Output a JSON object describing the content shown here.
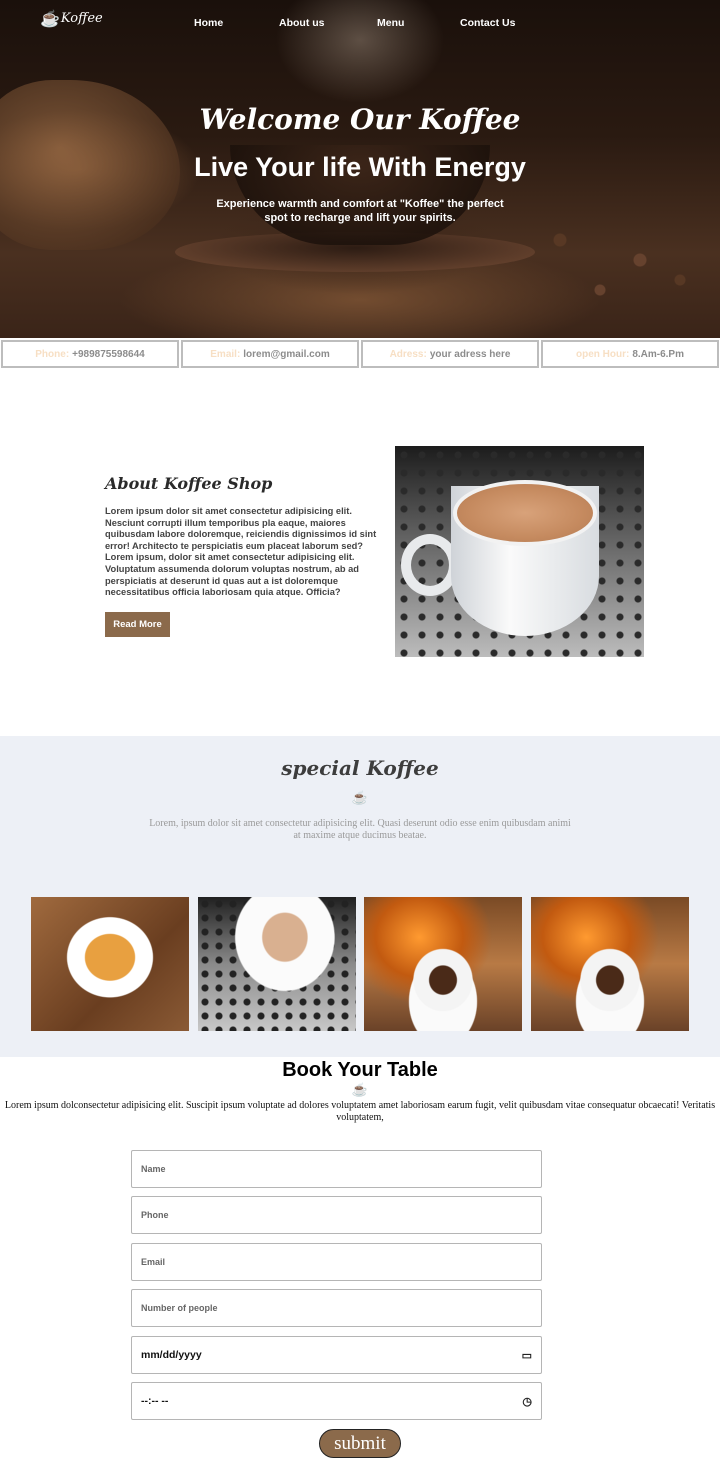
{
  "nav": {
    "logo_text": "Koffee",
    "logo_icon": "coffee-cup-icon",
    "links": [
      "Home",
      "About us",
      "Menu",
      "Contact Us"
    ]
  },
  "hero": {
    "title": "Welcome Our Koffee",
    "subtitle": "Live Your life With Energy",
    "description": "Experience warmth and comfort at \"Koffee\" the perfect spot to recharge and lift your spirits."
  },
  "info": [
    {
      "label": "Phone:",
      "value": "+989875598644"
    },
    {
      "label": "Email:",
      "value": "lorem@gmail.com"
    },
    {
      "label": "Adress:",
      "value": "your adress here"
    },
    {
      "label": "open Hour:",
      "value": "8.Am-6.Pm"
    }
  ],
  "about": {
    "title": "About Koffee Shop",
    "text": "Lorem ipsum dolor sit amet consectetur adipisicing elit. Nesciunt corrupti illum temporibus pla eaque, maiores quibusdam labore doloremque, reiciendis dignissimos id sint error! Architecto te perspiciatis eum placeat laborum sed? Lorem ipsum, dolor sit amet consectetur adipisicing elit. Voluptatum assumenda dolorum voluptas nostrum, ab ad perspiciatis at deserunt id quas aut a ist doloremque necessitatibus officia laboriosam quia atque. Officia?",
    "button_label": "Read More"
  },
  "special": {
    "title": "special Koffee",
    "icon": "☕",
    "description": "Lorem, ipsum dolor sit amet consectetur adipisicing elit. Quasi deserunt odio esse enim quibusdam animi at maxime atque ducimus beatae."
  },
  "book": {
    "title": "Book Your Table",
    "icon": "☕",
    "description": "Lorem ipsum dolconsectetur adipisicing elit. Suscipit ipsum voluptate ad dolores voluptatem amet laboriosam earum fugit, velit quibusdam vitae consequatur obcaecati! Veritatis voluptatem,",
    "fields": {
      "name_placeholder": "Name",
      "phone_placeholder": "Phone",
      "email_placeholder": "Email",
      "people_placeholder": "Number of people",
      "date_placeholder": "mm/dd/yyyy",
      "time_placeholder": "--:-- --"
    },
    "submit_label": "submit"
  },
  "colors": {
    "accent_brown": "#8b6a4b",
    "info_label": "#f7dfc4",
    "special_bg": "#edf0f6"
  }
}
